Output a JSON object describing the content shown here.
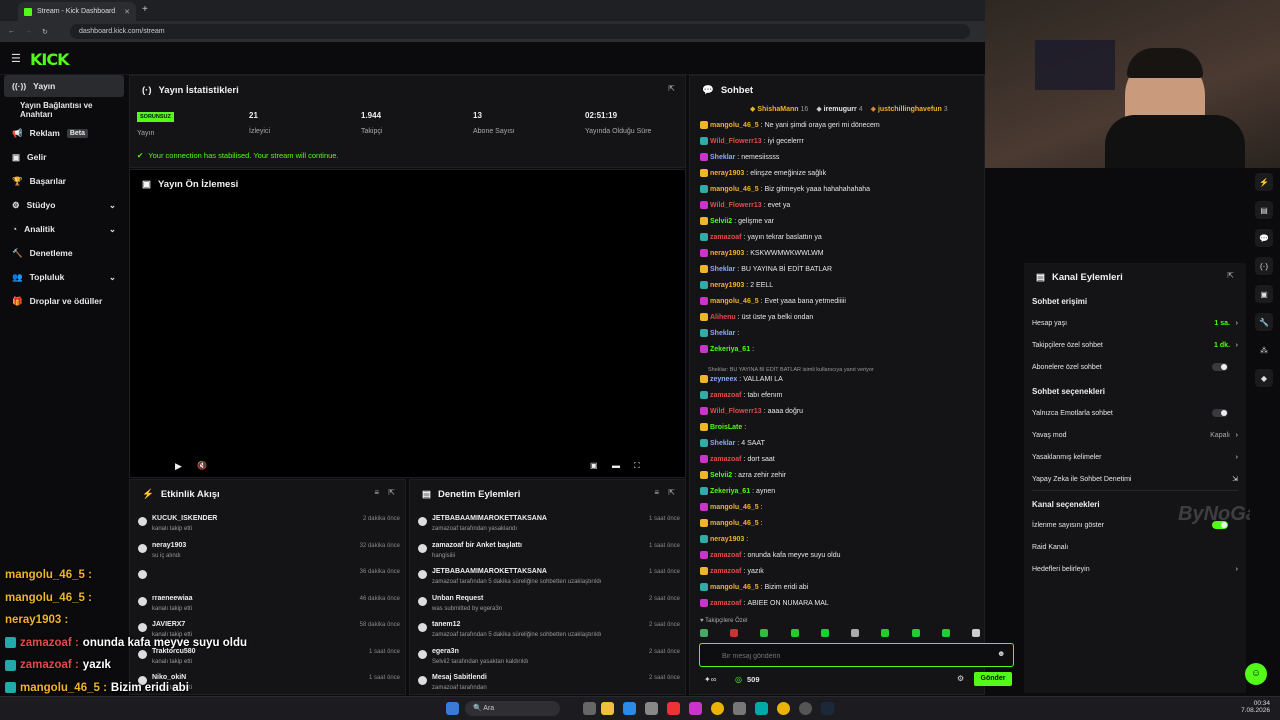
{
  "browser": {
    "tab_title": "Stream - Kick Dashboard",
    "url": "dashboard.kick.com/stream"
  },
  "logo": "KICK",
  "sidebar": {
    "items": [
      {
        "label": "Yayın",
        "icon": "broadcast-icon"
      },
      {
        "label": "Yayın Bağlantısı ve Anahtarı",
        "icon": ""
      },
      {
        "label": "Reklam",
        "badge": "Beta",
        "icon": "megaphone-icon"
      },
      {
        "label": "Gelir",
        "icon": "money-icon"
      },
      {
        "label": "Başarılar",
        "icon": "trophy-icon"
      },
      {
        "label": "Stüdyo",
        "icon": "studio-icon"
      },
      {
        "label": "Analitik",
        "icon": "chart-icon"
      },
      {
        "label": "Denetleme",
        "icon": "hammer-icon"
      },
      {
        "label": "Topluluk",
        "icon": "community-icon"
      },
      {
        "label": "Droplar ve ödüller",
        "icon": "gift-icon"
      }
    ]
  },
  "stats": {
    "title": "Yayın İstatistikleri",
    "items": [
      {
        "value": "SORUNSUZ",
        "label": "Yayın"
      },
      {
        "value": "21",
        "label": "İzleyici"
      },
      {
        "value": "1.944",
        "label": "Takipçi"
      },
      {
        "value": "13",
        "label": "Abone Sayısı"
      },
      {
        "value": "02:51:19",
        "label": "Yayında Olduğu Süre"
      }
    ],
    "connection": "Your connection has stabilised. Your stream will continue."
  },
  "preview": {
    "title": "Yayın Ön İzlemesi"
  },
  "activity": {
    "title": "Etkinlik Akışı",
    "items": [
      {
        "name": "KUCUK_ISKENDER",
        "sub": "kanalı takip etti",
        "time": "2 dakika önce"
      },
      {
        "name": "neray1903",
        "sub": "su iç alındı",
        "time": "32 dakika önce"
      },
      {
        "name": "",
        "sub": "",
        "time": "36 dakika önce"
      },
      {
        "name": "rraeneewiaa",
        "sub": "kanalı takip etti",
        "time": "46 dakika önce"
      },
      {
        "name": "JAVIERX7",
        "sub": "kanalı takip etti",
        "time": "58 dakika önce"
      },
      {
        "name": "Traktorcu580",
        "sub": "kanalı takip etti",
        "time": "1 saat önce"
      },
      {
        "name": "Niko_okiN",
        "sub": "kanalı takip etti",
        "time": "1 saat önce"
      }
    ]
  },
  "moderation": {
    "title": "Denetim Eylemleri",
    "items": [
      {
        "name": "JETBABAAMIMAROKETTAKSANA",
        "sub": "zamazoaf tarafından yasaklandı",
        "time": "1 saat önce"
      },
      {
        "name": "zamazoaf bir Anket başlattı",
        "sub": "hangisiiii",
        "time": "1 saat önce"
      },
      {
        "name": "JETBABAAMIMAROKETTAKSANA",
        "sub": "zamazoaf tarafından 5 dakika süreliğine sohbetten uzaklaştırıldı",
        "time": "1 saat önce"
      },
      {
        "name": "Unban Request",
        "sub": "was submitted by egera3n",
        "time": "2 saat önce"
      },
      {
        "name": "tanem12",
        "sub": "zamazoaf tarafından 5 dakika süreliğine sohbetten uzaklaştırıldı",
        "time": "2 saat önce"
      },
      {
        "name": "egera3n",
        "sub": "Selvii2 tarafından yasaktan kaldırıldı",
        "time": "2 saat önce"
      },
      {
        "name": "Mesaj Sabitlendi",
        "sub": "zamazoaf tarafından",
        "time": "2 saat önce"
      }
    ]
  },
  "chat": {
    "title": "Sohbet",
    "top_gifters": [
      {
        "name": "ShishaMann",
        "count": "16"
      },
      {
        "name": "iremugurr",
        "count": "4"
      },
      {
        "name": "justchillinghavefun",
        "count": "3"
      }
    ],
    "messages": [
      {
        "user": "mangolu_46_5",
        "text": "Ne yani şimdi oraya geri mi dönecem",
        "color": "#f0b429"
      },
      {
        "user": "Wild_Flowerr13",
        "text": "iyi gecelerrr",
        "color": "#e24c4c"
      },
      {
        "user": "Sheklar",
        "text": "nemesiissss",
        "color": "#8aa8ff"
      },
      {
        "user": "neray1903",
        "text": "elinşze emeğinize sağlık",
        "color": "#f0b429"
      },
      {
        "user": "mangolu_46_5",
        "text": "Biz gitmeyek yaaa hahahahahaha",
        "color": "#f0b429"
      },
      {
        "user": "Wild_Flowerr13",
        "text": "evet ya",
        "color": "#e24c4c"
      },
      {
        "user": "Selvii2",
        "text": "gelişme var",
        "color": "#53fc18"
      },
      {
        "user": "zamazoaf",
        "text": "yayın tekrar baslattın ya",
        "color": "#e24c4c"
      },
      {
        "user": "neray1903",
        "text": "KSKWWMWKWWLWM",
        "color": "#f0b429"
      },
      {
        "user": "Sheklar",
        "text": "BU YAYINA Bİ EDİT BATLAR",
        "color": "#8aa8ff"
      },
      {
        "user": "neray1903",
        "text": "2 EELL",
        "color": "#f0b429"
      },
      {
        "user": "mangolu_46_5",
        "text": "Evet yaaa bana yetmediiiii",
        "color": "#f0b429"
      },
      {
        "user": "Alihenu",
        "text": "üst üste ya belki ondan",
        "color": "#e24c4c"
      },
      {
        "user": "Sheklar",
        "text": "",
        "color": "#8aa8ff"
      },
      {
        "user": "Zekeriya_61",
        "text": "",
        "color": "#53fc18"
      },
      {
        "user": "zeyneex",
        "text": "VALLAMI LA",
        "color": "#8aa8ff"
      },
      {
        "user": "zamazoaf",
        "text": "tabı efenım",
        "color": "#e24c4c"
      },
      {
        "user": "Wild_Flowerr13",
        "text": "aaaa doğru",
        "color": "#e24c4c"
      },
      {
        "user": "BroisLate",
        "text": "",
        "color": "#53fc18"
      },
      {
        "user": "Sheklar",
        "text": "4 SAAT",
        "color": "#8aa8ff"
      },
      {
        "user": "zamazoaf",
        "text": "dort saat",
        "color": "#e24c4c"
      },
      {
        "user": "Selvii2",
        "text": "azra zehir zehir",
        "color": "#53fc18"
      },
      {
        "user": "Zekeriya_61",
        "text": "aynen",
        "color": "#53fc18"
      },
      {
        "user": "mangolu_46_5",
        "text": "",
        "color": "#f0b429"
      },
      {
        "user": "mangolu_46_5",
        "text": "",
        "color": "#f0b429"
      },
      {
        "user": "neray1903",
        "text": "",
        "color": "#f0b429"
      },
      {
        "user": "zamazoaf",
        "text": "onunda kafa meyve suyu oldu",
        "color": "#e24c4c"
      },
      {
        "user": "zamazoaf",
        "text": "yazık",
        "color": "#e24c4c"
      },
      {
        "user": "mangolu_46_5",
        "text": "Bizim eridi abi",
        "color": "#f0b429"
      },
      {
        "user": "zamazoaf",
        "text": "ABIEE ON NUMARA MAL",
        "color": "#e24c4c"
      }
    ],
    "reply_note": "Sheklar: BU YAYINA Bİ EDİT BATLAR isimli kullanıcıya yanıt veriyor",
    "followers_only": "Takipçilere Özel",
    "input_placeholder": "Bir mesaj gönderin",
    "points": "509",
    "send": "Gönder"
  },
  "channel_actions": {
    "title": "Kanal Eylemleri",
    "chat_access": "Sohbet erişimi",
    "account_age": {
      "label": "Hesap yaşı",
      "value": "1 sa."
    },
    "followers_chat": {
      "label": "Takipçilere özel sohbet",
      "value": "1 dk."
    },
    "subscribers_chat": {
      "label": "Abonelere özel sohbet"
    },
    "chat_options": "Sohbet seçenekleri",
    "emote_only": {
      "label": "Yalnızca Emotlarla sohbet"
    },
    "slow_mode": {
      "label": "Yavaş mod",
      "value": "Kapalı"
    },
    "banned_words": {
      "label": "Yasaklanmış kelimeler"
    },
    "ai_moderation": {
      "label": "Yapay Zeka ile Sohbet Denetimi"
    },
    "channel_options": "Kanal seçenekleri",
    "show_viewers": {
      "label": "İzlenme sayısını göster"
    },
    "raid": {
      "label": "Raid Kanalı"
    },
    "goals": {
      "label": "Hedefleri belirleyin"
    }
  },
  "overlay": {
    "watermark": "ByNoGame",
    "messages": [
      {
        "user": "mangolu_46_5 :",
        "text": "",
        "color": "#f0b429"
      },
      {
        "user": "mangolu_46_5 :",
        "text": "",
        "color": "#f0b429"
      },
      {
        "user": "neray1903 :",
        "text": "",
        "color": "#f0b429"
      },
      {
        "user": "zamazoaf :",
        "text": "onunda kafa meyve suyu oldu",
        "color": "#e24c4c"
      },
      {
        "user": "zamazoaf :",
        "text": "yazık",
        "color": "#e24c4c"
      },
      {
        "user": "mangolu_46_5 :",
        "text": "Bizim eridi abi",
        "color": "#f0b429"
      },
      {
        "user": "zamazoaf :",
        "text": "ABIEE ON NUMARA MAL",
        "color": "#e24c4c"
      }
    ]
  },
  "taskbar": {
    "search": "Ara",
    "time": "00:34",
    "date": "7.08.2026"
  }
}
